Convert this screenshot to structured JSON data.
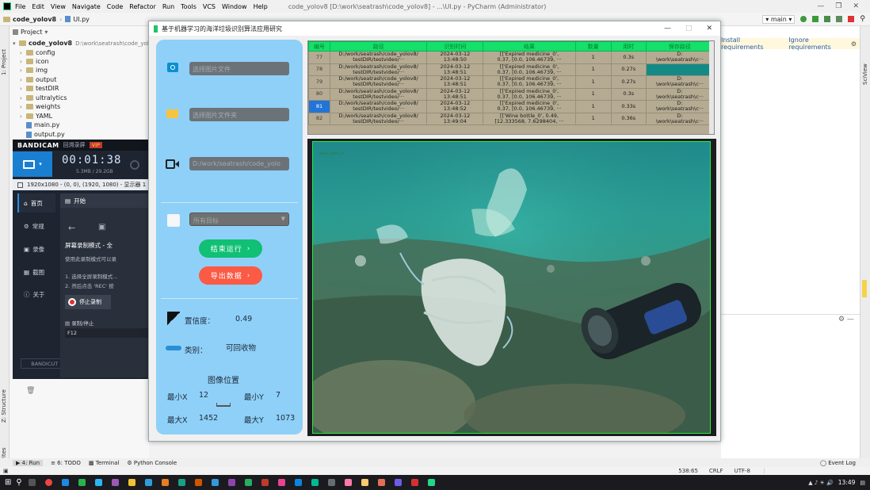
{
  "ide": {
    "menu": [
      "File",
      "Edit",
      "View",
      "Navigate",
      "Code",
      "Refactor",
      "Run",
      "Tools",
      "VCS",
      "Window",
      "Help"
    ],
    "window_title": "code_yolov8 [D:\\work\\seatrash\\code_yolov8] - ...\\UI.py - PyCharm (Administrator)",
    "breadcrumb_project": "code_yolov8",
    "breadcrumb_file": "UI.py",
    "branch": "main",
    "project_label": "Project",
    "root_name": "code_yolov8",
    "root_path": "D:\\work\\seatrash\\code_yolov8",
    "tree": [
      "config",
      "icon",
      "img",
      "output",
      "testDIR",
      "ultralytics",
      "weights",
      "YAML"
    ],
    "files": [
      "main.py",
      "output.py"
    ],
    "notif_install": "Install requirements",
    "notif_ignore": "Ignore requirements",
    "left_strip_top": "1: Project",
    "left_strip_mid": "Z: Structure",
    "left_strip_bot": "2: Favorites",
    "right_strip": "SciView",
    "run_label": "Run",
    "bottom_tabs": [
      "4: Run",
      "6: TODO",
      "Terminal",
      "Python Console"
    ],
    "event_log": "Event Log",
    "status_pos": "538:65",
    "status_crlf": "CRLF",
    "status_enc": "UTF-8",
    "clock": "13:49"
  },
  "bandicam": {
    "logo": "BANDICAM",
    "sub": "回溯录屏",
    "vip": "VIP",
    "timer": "00:01:38",
    "size": "5.3MB / 29.2GB",
    "resolution": "1920x1080 - (0, 0), (1920, 1080) - 显示器 1",
    "nav": [
      "首页",
      "常规",
      "录像",
      "截图",
      "关于"
    ],
    "tab_start": "开始",
    "mode_title": "屏幕录制模式 - 全",
    "mode_desc": "使用此录制模式可以录",
    "step1": "1. 选择全屏录制模式...",
    "step2": "2. 然后点击 'REC' 按",
    "stop": "停止录制",
    "hotkey_label": "录制/停止",
    "hotkey": "F12",
    "bandicut": "BANDICUT ↗"
  },
  "app": {
    "title": "基于机器学习的海洋垃圾识别算法应用研究",
    "select_image": "选择图片文件",
    "select_folder": "选择图片文件夹",
    "video_path": "D:/work/seatrash/code_yolo",
    "target_select": "所有目标",
    "stop_button": "结束运行",
    "export_button": "导出数据",
    "confidence_label": "置信度：",
    "confidence_value": "0.49",
    "class_label": "类别：",
    "class_value": "可回收物",
    "position_title": "图像位置",
    "xmin_label": "最小X",
    "xmin": "12",
    "ymin_label": "最小Y",
    "ymin": "7",
    "xmax_label": "最大X",
    "xmax": "1452",
    "ymax_label": "最大Y",
    "ymax": "1073",
    "video_overlay": "Wine bottle_0"
  },
  "table": {
    "headers": [
      "编号",
      "路径",
      "识别时间",
      "结果",
      "数量",
      "用时",
      "保存路径"
    ],
    "rows": [
      [
        "77",
        "D:/work/seatrash/code_yolov8/\ntestDIR/testvideo/···",
        "2024-03-12\n13:48:50",
        "[['Expired medicine_0',\n0.37, [0.0, 106.46739, ···",
        "1",
        "0.3s",
        "D:\n\\work\\seatrash\\c···"
      ],
      [
        "78",
        "D:/work/seatrash/code_yolov8/\ntestDIR/testvideo/···",
        "2024-03-12\n13:48:51",
        "[['Expired medicine_0',\n0.37, [0.0, 106.46739, ···",
        "1",
        "0.27s",
        ""
      ],
      [
        "79",
        "D:/work/seatrash/code_yolov8/\ntestDIR/testvideo/···",
        "2024-03-12\n13:48:51",
        "[['Expired medicine_0',\n0.37, [0.0, 106.46739, ···",
        "1",
        "0.27s",
        "D:\n\\work\\seatrash\\c···"
      ],
      [
        "80",
        "D:/work/seatrash/code_yolov8/\ntestDIR/testvideo/···",
        "2024-03-12\n13:48:51",
        "[['Expired medicine_0',\n0.37, [0.0, 106.46739, ···",
        "1",
        "0.3s",
        "D:\n\\work\\seatrash\\c···"
      ],
      [
        "81",
        "D:/work/seatrash/code_yolov8/\ntestDIR/testvideo/···",
        "2024-03-12\n13:48:52",
        "[['Expired medicine_0',\n0.37, [0.0, 106.46739, ···",
        "1",
        "0.33s",
        "D:\n\\work\\seatrash\\c···"
      ],
      [
        "82",
        "D:/work/seatrash/code_yolov8/\ntestDIR/testvideo/···",
        "2024-03-12\n13:49:04",
        "[['Wine bottle_0', 0.49,\n[12.333568, 7.6298404, ···",
        "1",
        "0.36s",
        "D:\n\\work\\seatrash\\c···"
      ]
    ]
  },
  "colors": {
    "stop_button": "#10c074",
    "export_button": "#fb5a45",
    "panel": "#8fd0f8",
    "table_header": "#14e06a",
    "selected_row": "#2275d6"
  }
}
